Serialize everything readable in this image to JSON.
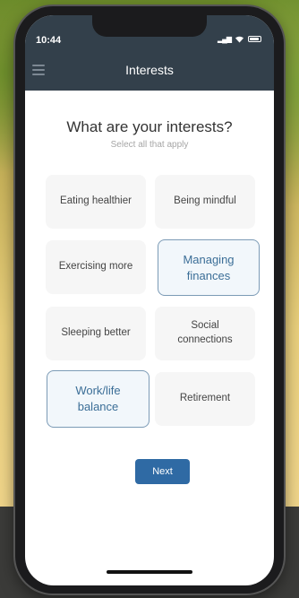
{
  "status_bar": {
    "time": "10:44"
  },
  "header": {
    "title": "Interests"
  },
  "prompt": {
    "question": "What are your interests?",
    "subtitle": "Select all that apply"
  },
  "interests": [
    {
      "label_lines": [
        "Eating healthier"
      ],
      "selected": false
    },
    {
      "label_lines": [
        "Being mindful"
      ],
      "selected": false
    },
    {
      "label_lines": [
        "Exercising more"
      ],
      "selected": false
    },
    {
      "label_lines": [
        "Managing",
        "finances"
      ],
      "selected": true
    },
    {
      "label_lines": [
        "Sleeping better"
      ],
      "selected": false
    },
    {
      "label_lines": [
        "Social",
        "connections"
      ],
      "selected": false
    },
    {
      "label_lines": [
        "Work/life",
        "balance"
      ],
      "selected": true
    },
    {
      "label_lines": [
        "Retirement"
      ],
      "selected": false
    }
  ],
  "next_button": {
    "label": "Next"
  },
  "colors": {
    "header": "#33404b",
    "selected_border": "#7c9bb6",
    "selected_text": "#3b6e97",
    "button": "#2f6aa4"
  }
}
